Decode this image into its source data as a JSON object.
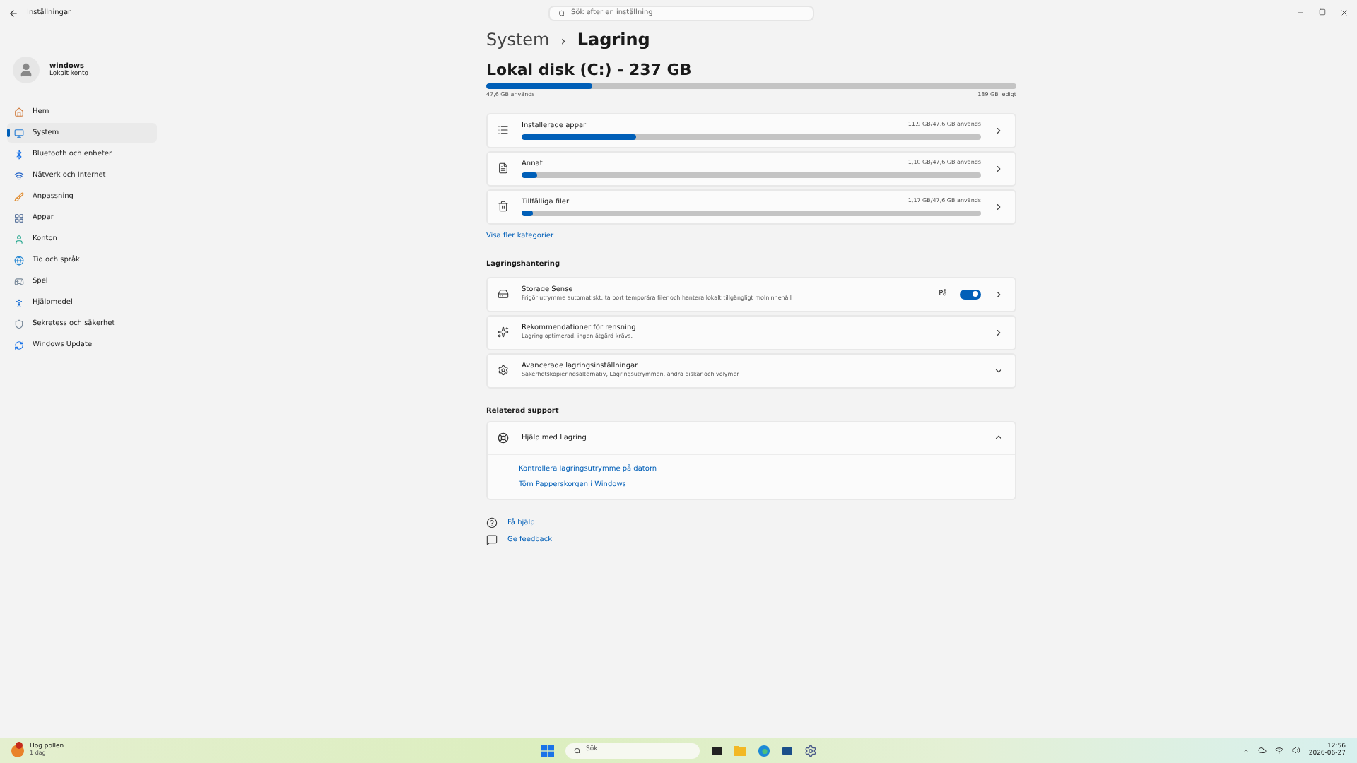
{
  "window": {
    "title": "Inställningar",
    "search": {
      "placeholder": "Sök efter en inställning"
    }
  },
  "account": {
    "name": "windows",
    "type": "Lokalt konto"
  },
  "sidebar": {
    "items": [
      {
        "label": "Hem",
        "selected": false
      },
      {
        "label": "System",
        "selected": true
      },
      {
        "label": "Bluetooth och enheter",
        "selected": false
      },
      {
        "label": "Nätverk och Internet",
        "selected": false
      },
      {
        "label": "Anpassning",
        "selected": false
      },
      {
        "label": "Appar",
        "selected": false
      },
      {
        "label": "Konton",
        "selected": false
      },
      {
        "label": "Tid och språk",
        "selected": false
      },
      {
        "label": "Spel",
        "selected": false
      },
      {
        "label": "Hjälpmedel",
        "selected": false
      },
      {
        "label": "Sekretess och säkerhet",
        "selected": false
      },
      {
        "label": "Windows Update",
        "selected": false
      }
    ]
  },
  "breadcrumb": {
    "parent": "System",
    "separator": "›",
    "current": "Lagring"
  },
  "disk": {
    "title": "Lokal disk (C:) - 237 GB",
    "level": 0.2,
    "used": "47,6 GB används",
    "free": "189 GB ledigt"
  },
  "categories": [
    {
      "label": "Installerade appar",
      "reading": "11,9 GB/47,6 GB används",
      "level": 0.25
    },
    {
      "label": "Annat",
      "reading": "1,10 GB/47,6 GB används",
      "level": 0.035
    },
    {
      "label": "Tillfälliga filer",
      "reading": "1,17 GB/47,6 GB används",
      "level": 0.025
    }
  ],
  "more_link": "Visa fler kategorier",
  "management": {
    "heading": "Lagringshantering",
    "items": [
      {
        "kind": "toggle",
        "title": "Storage Sense",
        "subtitle": "Frigör utrymme automatiskt, ta bort temporära filer och hantera lokalt tillgängligt molninnehåll",
        "state_label": "På",
        "on": true
      },
      {
        "kind": "link",
        "title": "Rekommendationer för rensning",
        "subtitle": "Lagring optimerad, ingen åtgärd krävs."
      },
      {
        "kind": "expand",
        "title": "Avancerade lagringsinställningar",
        "subtitle": "Säkerhetskopieringsalternativ, Lagringsutrymmen, andra diskar och volymer",
        "expanded": false
      }
    ]
  },
  "support": {
    "heading": "Relaterad support",
    "title": "Hjälp med Lagring",
    "expanded": true,
    "links": [
      "Kontrollera lagringsutrymme på datorn",
      "Töm Papperskorgen i Windows"
    ]
  },
  "footer_links": [
    {
      "label": "Få hjälp"
    },
    {
      "label": "Ge feedback"
    }
  ],
  "taskbar": {
    "weather": {
      "title": "Hög pollen",
      "subtitle": "1 dag"
    },
    "search": {
      "placeholder": "Sök"
    },
    "time": "12:56",
    "date": "2026-06-27"
  }
}
